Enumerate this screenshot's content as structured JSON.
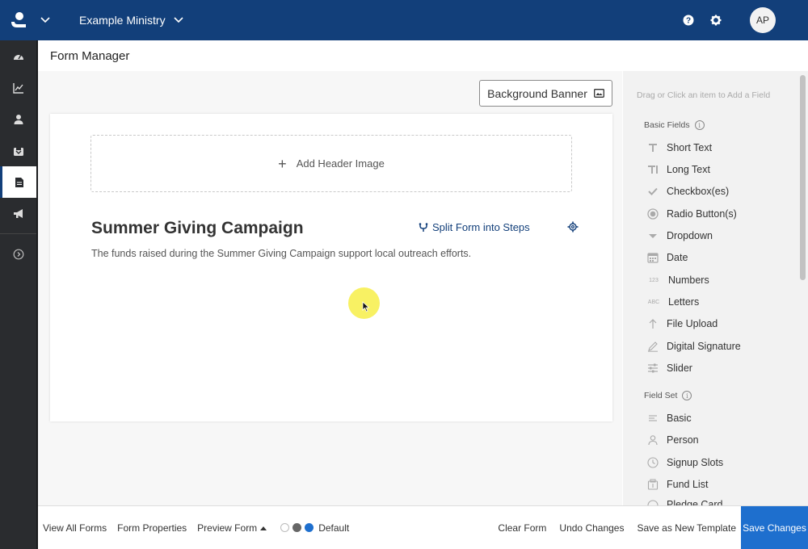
{
  "topbar": {
    "ministry_name": "Example Ministry",
    "avatar_initials": "AP",
    "bg_color": "#123f7a"
  },
  "sidebar": {
    "items": [
      {
        "icon": "dashboard-icon"
      },
      {
        "icon": "chart-icon"
      },
      {
        "icon": "person-icon"
      },
      {
        "icon": "inbox-icon"
      },
      {
        "icon": "document-icon",
        "active": true
      },
      {
        "icon": "megaphone-icon"
      },
      {
        "icon": "expand-circle-icon"
      }
    ]
  },
  "page": {
    "title": "Form Manager",
    "background_banner_label": "Background Banner"
  },
  "form": {
    "add_header_image_label": "Add Header Image",
    "title": "Summer Giving Campaign",
    "split_label": "Split Form into Steps",
    "description": "The funds raised during the Summer Giving Campaign support local outreach efforts."
  },
  "panel": {
    "hint": "Drag or Click an item to Add a Field",
    "basic_fields_heading": "Basic Fields",
    "basic_fields": [
      {
        "label": "Short Text",
        "icon": "text-t-icon"
      },
      {
        "label": "Long Text",
        "icon": "paragraph-icon"
      },
      {
        "label": "Checkbox(es)",
        "icon": "checkmark-icon"
      },
      {
        "label": "Radio Button(s)",
        "icon": "radio-icon"
      },
      {
        "label": "Dropdown",
        "icon": "caret-down-icon"
      },
      {
        "label": "Date",
        "icon": "calendar-icon"
      },
      {
        "label": "Numbers",
        "icon": "numbers-icon",
        "glyph": "123"
      },
      {
        "label": "Letters",
        "icon": "letters-icon",
        "glyph": "ABC"
      },
      {
        "label": "File Upload",
        "icon": "upload-icon"
      },
      {
        "label": "Digital Signature",
        "icon": "pen-icon"
      },
      {
        "label": "Slider",
        "icon": "sliders-icon"
      }
    ],
    "field_set_heading": "Field Set",
    "field_set": [
      {
        "label": "Basic",
        "icon": "lines-icon"
      },
      {
        "label": "Person",
        "icon": "person-icon"
      },
      {
        "label": "Signup Slots",
        "icon": "clock-icon"
      },
      {
        "label": "Fund List",
        "icon": "fund-icon"
      },
      {
        "label": "Pledge Card",
        "icon": "pledge-icon"
      }
    ]
  },
  "bottombar": {
    "view_all": "View All Forms",
    "properties": "Form Properties",
    "preview": "Preview Form",
    "theme_label": "Default",
    "clear": "Clear Form",
    "undo": "Undo Changes",
    "save_template": "Save as New Template",
    "save": "Save Changes",
    "theme_colors": [
      "#ffffff",
      "#666666",
      "#1e6fce"
    ],
    "save_color": "#1e6fce"
  }
}
